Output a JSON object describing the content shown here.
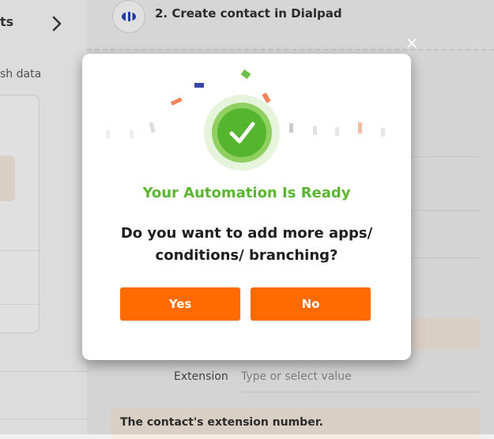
{
  "left_panel": {
    "title": "ts",
    "subtitle": "sh data"
  },
  "step": {
    "title": "2. Create contact in Dialpad",
    "logo_icon": "dialpad-logo-icon"
  },
  "form": {
    "extension_label": "Extension",
    "extension_placeholder": "Type or select value",
    "extension_help": "The contact's extension number."
  },
  "modal": {
    "heading": "Your Automation Is Ready",
    "question": "Do you want to add more apps/ conditions/ branching?",
    "yes_label": "Yes",
    "no_label": "No",
    "close_symbol": "×",
    "success_icon": "checkmark-icon"
  },
  "colors": {
    "accent_orange": "#ff6b00",
    "success_green": "#5ab531",
    "help_bg": "#f8ebe0"
  }
}
